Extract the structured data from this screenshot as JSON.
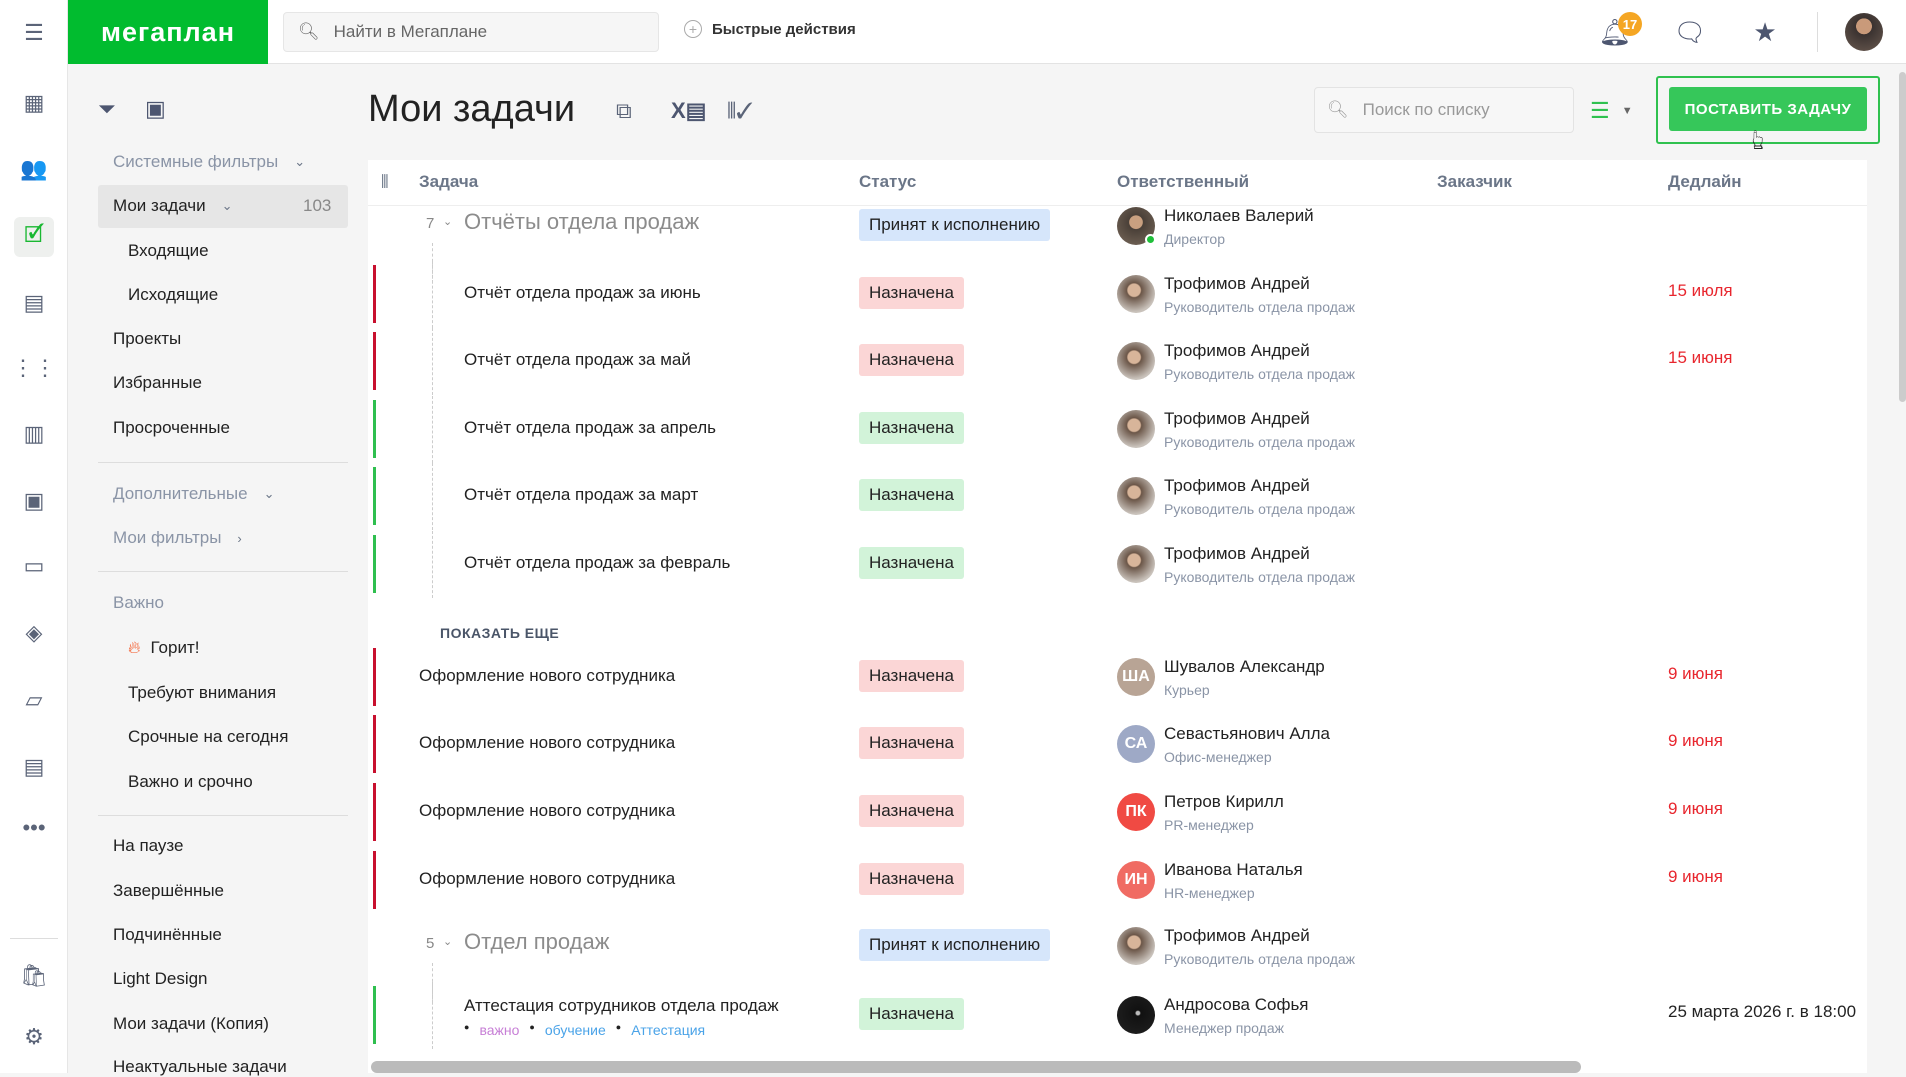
{
  "header": {
    "logo": "мегаплан",
    "search_placeholder": "Найти в Мегаплане",
    "quick_actions": "Быстрые действия",
    "notifications_count": "17"
  },
  "filters": {
    "system": "Системные фильтры",
    "my_tasks": "Мои задачи",
    "my_tasks_count": "103",
    "incoming": "Входящие",
    "outgoing": "Исходящие",
    "projects": "Проекты",
    "favorites": "Избранные",
    "overdue": "Просроченные",
    "additional": "Дополнительные",
    "my_filters": "Мои фильтры",
    "important": "Важно",
    "burning": "Горит!",
    "attention": "Требуют внимания",
    "urgent_today": "Срочные на сегодня",
    "important_urgent": "Важно и срочно",
    "paused": "На паузе",
    "completed": "Завершённые",
    "subordinate": "Подчинённые",
    "light_design": "Light Design",
    "my_tasks_copy": "Мои задачи (Копия)",
    "irrelevant": "Неактуальные задачи"
  },
  "main": {
    "title": "Мои задачи",
    "list_search_placeholder": "Поиск по списку",
    "add_task": "ПОСТАВИТЬ ЗАДАЧУ",
    "show_more": "ПОКАЗАТЬ ЕЩЕ",
    "columns": {
      "task": "Задача",
      "status": "Статус",
      "responsible": "Ответственный",
      "customer": "Заказчик",
      "deadline": "Дедлайн"
    }
  },
  "colors": {
    "brand": "#01bc2f",
    "red": "#e8262e",
    "assigned_bg": "#fbd6d6",
    "assigned_green_bg": "#d2f3d9",
    "accepted_bg": "#d6e6fb",
    "bar_red": "#c8102e",
    "bar_green": "#2fbf4f"
  },
  "rows": [
    {
      "type": "group",
      "count": "7",
      "name": "Отчёты отдела продаж",
      "status": "Принят к исполнению",
      "status_kind": "accepted",
      "person": "Николаев Валерий",
      "role": "Директор",
      "avatar": "photo1",
      "deadline": ""
    },
    {
      "type": "child",
      "name": "Отчёт отдела продаж за июнь",
      "status": "Назначена",
      "status_kind": "red",
      "bar": "red",
      "person": "Трофимов Андрей",
      "role": "Руководитель отдела продаж",
      "avatar": "photo2",
      "deadline": "15 июля",
      "deadline_red": true
    },
    {
      "type": "child",
      "name": "Отчёт отдела продаж за май",
      "status": "Назначена",
      "status_kind": "red",
      "bar": "red",
      "person": "Трофимов Андрей",
      "role": "Руководитель отдела продаж",
      "avatar": "photo2",
      "deadline": "15 июня",
      "deadline_red": true
    },
    {
      "type": "child",
      "name": "Отчёт отдела продаж за апрель",
      "status": "Назначена",
      "status_kind": "green",
      "bar": "green",
      "person": "Трофимов Андрей",
      "role": "Руководитель отдела продаж",
      "avatar": "photo2",
      "deadline": ""
    },
    {
      "type": "child",
      "name": "Отчёт отдела продаж за март",
      "status": "Назначена",
      "status_kind": "green",
      "bar": "green",
      "person": "Трофимов Андрей",
      "role": "Руководитель отдела продаж",
      "avatar": "photo2",
      "deadline": ""
    },
    {
      "type": "child",
      "name": "Отчёт отдела продаж за февраль",
      "status": "Назначена",
      "status_kind": "green",
      "bar": "green",
      "person": "Трофимов Андрей",
      "role": "Руководитель отдела продаж",
      "avatar": "photo2",
      "deadline": ""
    },
    {
      "type": "showmore"
    },
    {
      "type": "task",
      "name": "Оформление нового сотрудника",
      "status": "Назначена",
      "status_kind": "red",
      "bar": "red",
      "person": "Шувалов Александр",
      "role": "Курьер",
      "avatar": "ША",
      "avatar_color": "#b8a495",
      "deadline": "9 июня",
      "deadline_red": true
    },
    {
      "type": "task",
      "name": "Оформление нового сотрудника",
      "status": "Назначена",
      "status_kind": "red",
      "bar": "red",
      "person": "Севастьянович Алла",
      "role": "Офис-менеджер",
      "avatar": "СА",
      "avatar_color": "#9ea9c6",
      "deadline": "9 июня",
      "deadline_red": true
    },
    {
      "type": "task",
      "name": "Оформление нового сотрудника",
      "status": "Назначена",
      "status_kind": "red",
      "bar": "red",
      "person": "Петров Кирилл",
      "role": "PR-менеджер",
      "avatar": "ПК",
      "avatar_color": "#f04a43",
      "deadline": "9 июня",
      "deadline_red": true
    },
    {
      "type": "task",
      "name": "Оформление нового сотрудника",
      "status": "Назначена",
      "status_kind": "red",
      "bar": "red",
      "person": "Иванова Наталья",
      "role": "HR-менеджер",
      "avatar": "ИН",
      "avatar_color": "#f06b63",
      "deadline": "9 июня",
      "deadline_red": true
    },
    {
      "type": "group",
      "count": "5",
      "name": "Отдел продаж",
      "status": "Принят к исполнению",
      "status_kind": "accepted",
      "person": "Трофимов Андрей",
      "role": "Руководитель отдела продаж",
      "avatar": "photo2",
      "deadline": ""
    },
    {
      "type": "child",
      "name": "Аттестация сотрудников отдела продаж",
      "status": "Назначена",
      "status_kind": "green",
      "bar": "green",
      "person": "Андросова Софья",
      "role": "Менеджер продаж",
      "avatar": "photo3",
      "deadline": "25 марта 2026 г. в 18:00",
      "tags": [
        {
          "label": "важно",
          "color": "#c77fd6"
        },
        {
          "label": "обучение",
          "color": "#4aa3e8"
        },
        {
          "label": "Аттестация",
          "color": "#4aa3e8"
        }
      ]
    }
  ]
}
